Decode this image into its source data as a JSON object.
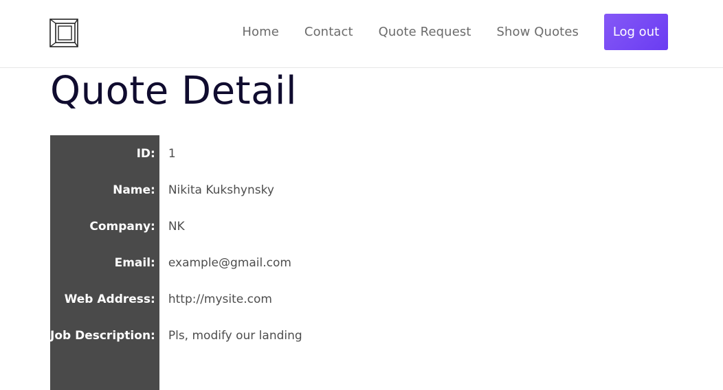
{
  "header": {
    "logo_icon": "nested-squares-logo-icon",
    "nav": [
      {
        "label": "Home"
      },
      {
        "label": "Contact"
      },
      {
        "label": "Quote Request"
      },
      {
        "label": "Show Quotes"
      }
    ],
    "logout_label": "Log out",
    "colors": {
      "button_gradient_start": "#8558f6",
      "button_gradient_end": "#6a3cf2",
      "nav_text": "#6b6b6b"
    }
  },
  "page": {
    "title": "Quote Detail",
    "title_color": "#100c2f"
  },
  "details": {
    "label_bg": "#4a4a4a",
    "rows": [
      {
        "label": "ID:",
        "value": "1"
      },
      {
        "label": "Name:",
        "value": "Nikita Kukshynsky"
      },
      {
        "label": "Company:",
        "value": "NK"
      },
      {
        "label": "Email:",
        "value": "example@gmail.com"
      },
      {
        "label": "Web Address:",
        "value": "http://mysite.com"
      },
      {
        "label": "Job Description:",
        "value": "Pls, modify our landing"
      }
    ]
  }
}
